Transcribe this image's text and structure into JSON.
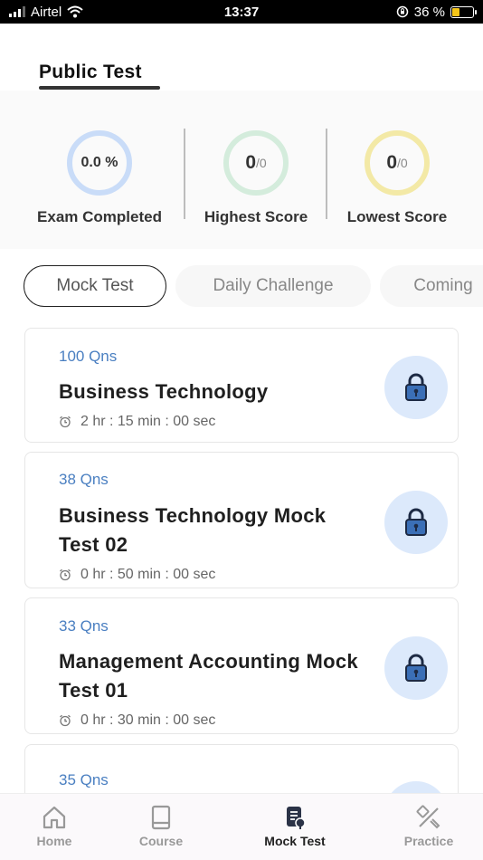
{
  "status_bar": {
    "carrier": "Airtel",
    "time": "13:37",
    "battery": "36 %",
    "battery_level": 0.36
  },
  "header": {
    "tab_label": "Public Test"
  },
  "stats": {
    "exam_completed": {
      "value": "0.0 %",
      "label": "Exam Completed"
    },
    "highest_score": {
      "value": "0",
      "total": "/0",
      "label": "Highest Score"
    },
    "lowest_score": {
      "value": "0",
      "total": "/0",
      "label": "Lowest Score"
    }
  },
  "filters": [
    {
      "label": "Mock Test",
      "active": true
    },
    {
      "label": "Daily Challenge",
      "active": false
    },
    {
      "label": "Coming",
      "active": false
    }
  ],
  "tests": [
    {
      "qns": "100 Qns",
      "title": "Business  Technology",
      "time": "2 hr : 15 min : 00 sec"
    },
    {
      "qns": "38 Qns",
      "title": "Business Technology Mock Test 02",
      "time": "0 hr : 50 min : 00 sec"
    },
    {
      "qns": "33 Qns",
      "title": "Management Accounting Mock Test 01",
      "time": "0 hr : 30 min : 00 sec"
    },
    {
      "qns": "35 Qns"
    }
  ],
  "icons": {
    "lock": "lock-icon",
    "clock": "alarm-clock-icon"
  },
  "colors": {
    "accent_blue": "#4a7fc1",
    "lock_bg": "#dce9fb",
    "ring_blue": "#c9dcf8",
    "ring_green": "#d4ecdc",
    "ring_yellow": "#f3e9a6"
  },
  "bottom_nav": {
    "home": "Home",
    "course": "Course",
    "mock_test": "Mock Test",
    "practice": "Practice",
    "active": "Mock Test"
  }
}
